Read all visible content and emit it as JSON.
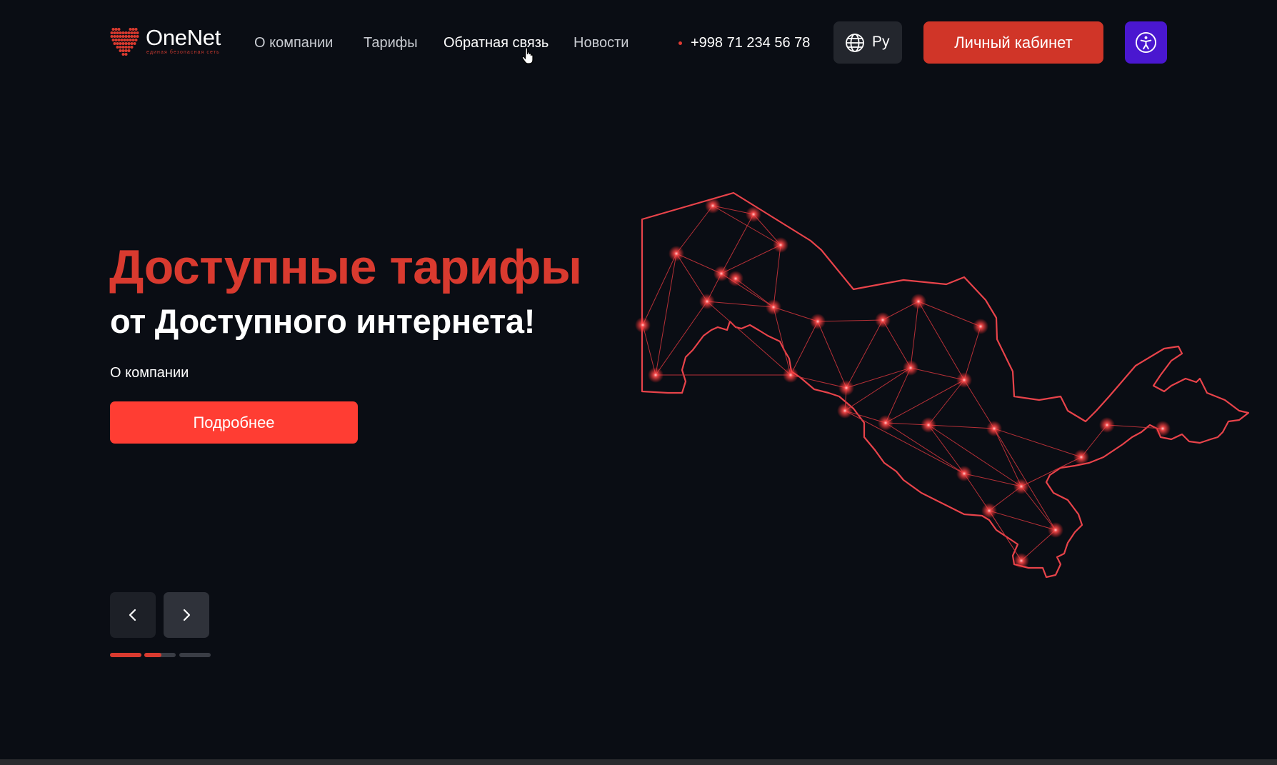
{
  "brand": {
    "name": "OneNet",
    "tagline": "единая безопасная сеть",
    "logo_icon": "heart-grid-logo"
  },
  "nav": {
    "items": [
      {
        "label": "О компании",
        "active": false
      },
      {
        "label": "Тарифы",
        "active": false
      },
      {
        "label": "Обратная связь",
        "active": true
      },
      {
        "label": "Новости",
        "active": false
      }
    ]
  },
  "contact": {
    "phone": "+998 71 234 56 78"
  },
  "language": {
    "current": "Ру",
    "icon": "globe-icon"
  },
  "cabinet_button": "Личный кабинет",
  "accessibility_button": {
    "icon": "accessibility-icon"
  },
  "hero": {
    "title": "Доступные тарифы",
    "subtitle": "от Доступного интернета!",
    "link_label": "О компании",
    "cta_label": "Подробнее",
    "slider": {
      "total_slides": 3,
      "current_slide": 2,
      "progress": [
        1.0,
        0.55,
        0.0
      ]
    },
    "map_label": "Uzbekistan network map"
  },
  "colors": {
    "background": "#0a0d14",
    "accent_red": "#d93a2f",
    "cta_red": "#ff3d33",
    "accessibility_purple": "#4a17d0"
  }
}
